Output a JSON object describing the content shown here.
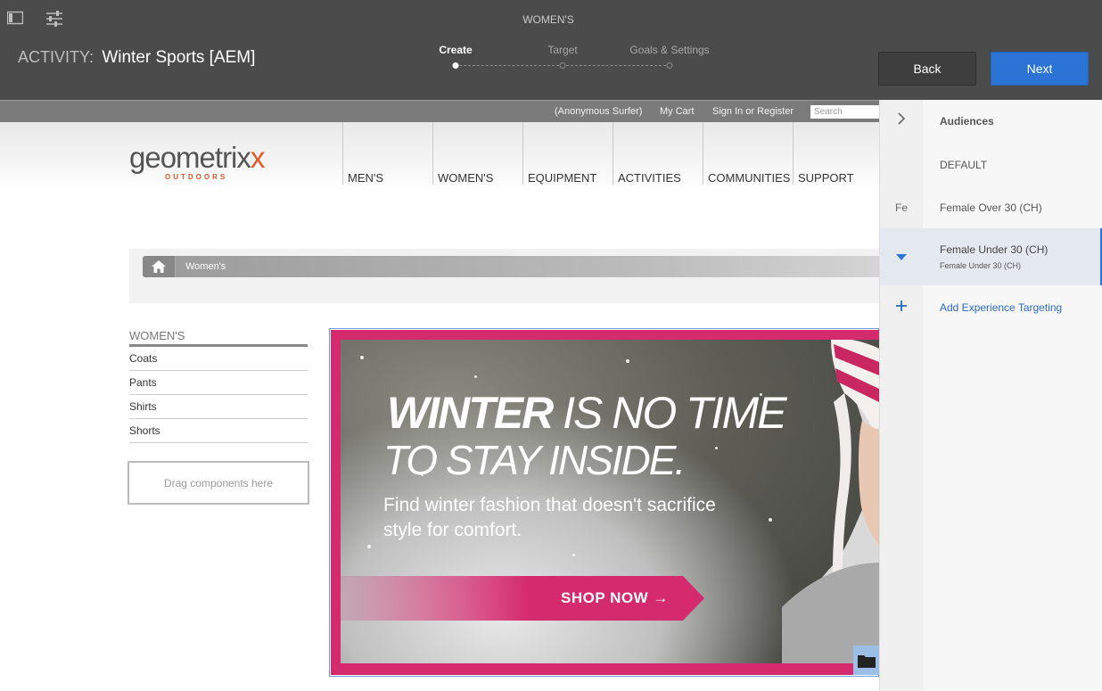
{
  "topbar": {
    "page_name": "WOMEN'S",
    "activity_label": "ACTIVITY:",
    "activity_name": "Winter Sports [AEM]",
    "steps": [
      {
        "label": "Create",
        "active": true
      },
      {
        "label": "Target",
        "active": false
      },
      {
        "label": "Goals & Settings",
        "active": false
      }
    ],
    "back_label": "Back",
    "next_label": "Next",
    "icons": [
      "sidebar-toggle-icon",
      "sliders-icon"
    ]
  },
  "site": {
    "utility_links": [
      "(Anonymous Surfer)",
      "My Cart",
      "Sign In or Register"
    ],
    "search_placeholder": "Search",
    "logo_text": "geometrixx",
    "logo_subtext": "OUTDOORS",
    "nav": [
      "MEN'S",
      "WOMEN'S",
      "EQUIPMENT",
      "ACTIVITIES",
      "COMMUNITIES",
      "SUPPORT"
    ],
    "breadcrumb": "Women's",
    "leftnav_heading": "WOMEN'S",
    "leftnav_items": [
      "Coats",
      "Pants",
      "Shirts",
      "Shorts"
    ],
    "dropzone": "Drag components here",
    "hero": {
      "headline_bold": "WINTER",
      "headline_rest": " IS NO TIME",
      "headline_line2": "TO STAY INSIDE.",
      "subtext": "Find winter fashion that doesn't sacrifice style for comfort.",
      "cta": "SHOP NOW",
      "cta_arrow": "→"
    }
  },
  "panel": {
    "heading": "Audiences",
    "rows": [
      {
        "icon": "",
        "label": "DEFAULT",
        "sublabel": ""
      },
      {
        "icon": "Fe",
        "label": "Female Over 30 (CH)",
        "sublabel": ""
      },
      {
        "icon": "caret-down-icon",
        "label": "Female Under 30 (CH)",
        "sublabel": "Female Under 30 (CH)"
      }
    ],
    "add_label": "Add Experience Targeting"
  },
  "colors": {
    "topbar": "#4b4b4b",
    "next_button": "#2b74d6",
    "hero_magenta": "#d62a6e",
    "link_blue": "#2b6cc4",
    "logo_accent": "#e0592a"
  }
}
